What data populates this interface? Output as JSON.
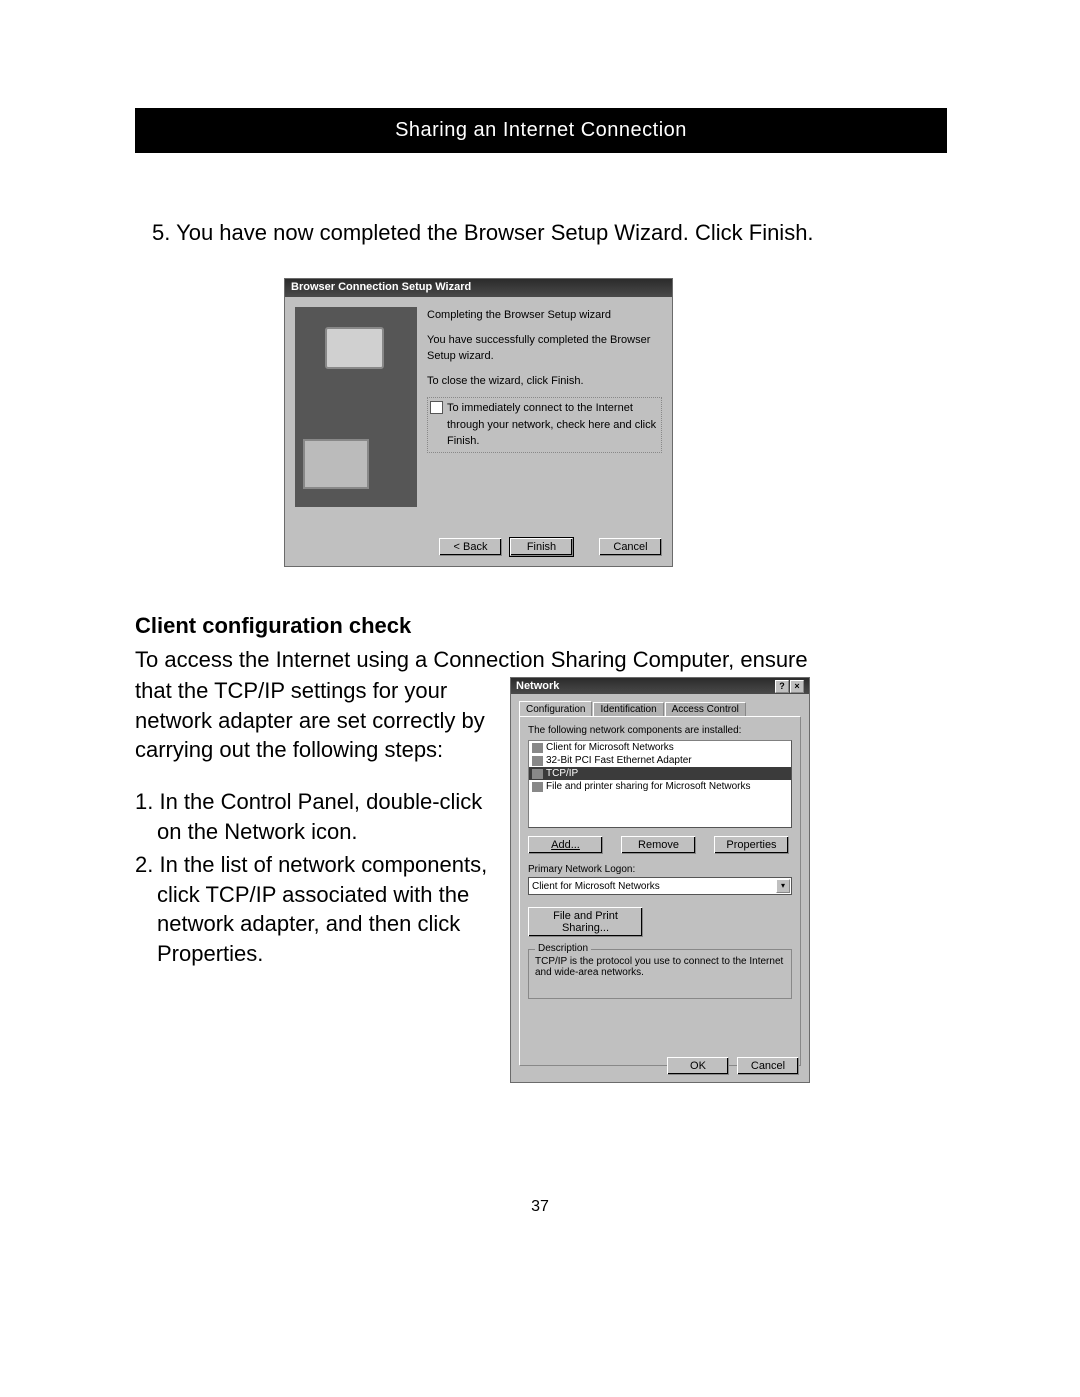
{
  "header": {
    "title": "Sharing an Internet Connection"
  },
  "step5": "5. You have now completed the Browser Setup Wizard. Click Finish.",
  "wizard": {
    "title": "Browser Connection Setup Wizard",
    "line1": "Completing the Browser Setup wizard",
    "line2": "You have successfully completed the Browser Setup wizard.",
    "line3": "To close the wizard, click Finish.",
    "checkbox": "To immediately connect to the Internet through your network, check here and click Finish.",
    "back": "< Back",
    "finish": "Finish",
    "cancel": "Cancel"
  },
  "section_heading": "Client configuration check",
  "para_line1": "To access the Internet using a Connection Sharing Computer, ensure",
  "para_rest": "that the TCP/IP settings for your network adapter are set correctly by carrying out the following steps:",
  "steps": {
    "s1": "1. In the Control Panel, double-click on the Network icon.",
    "s2": "2. In the list of network components, click TCP/IP associated with the network adapter, and then click Properties."
  },
  "network": {
    "title": "Network",
    "help_btn": "?",
    "close_btn": "×",
    "tabs": {
      "t1": "Configuration",
      "t2": "Identification",
      "t3": "Access Control"
    },
    "list_label": "The following network components are installed:",
    "items": [
      "Client for Microsoft Networks",
      "32-Bit PCI Fast Ethernet Adapter",
      "TCP/IP",
      "File and printer sharing for Microsoft Networks"
    ],
    "add": "Add...",
    "remove": "Remove",
    "properties": "Properties",
    "logon_label": "Primary Network Logon:",
    "logon_value": "Client for Microsoft Networks",
    "fps": "File and Print Sharing...",
    "desc_legend": "Description",
    "desc_text": "TCP/IP is the protocol you use to connect to the Internet and wide-area networks.",
    "ok": "OK",
    "cancel": "Cancel"
  },
  "page_number": "37"
}
